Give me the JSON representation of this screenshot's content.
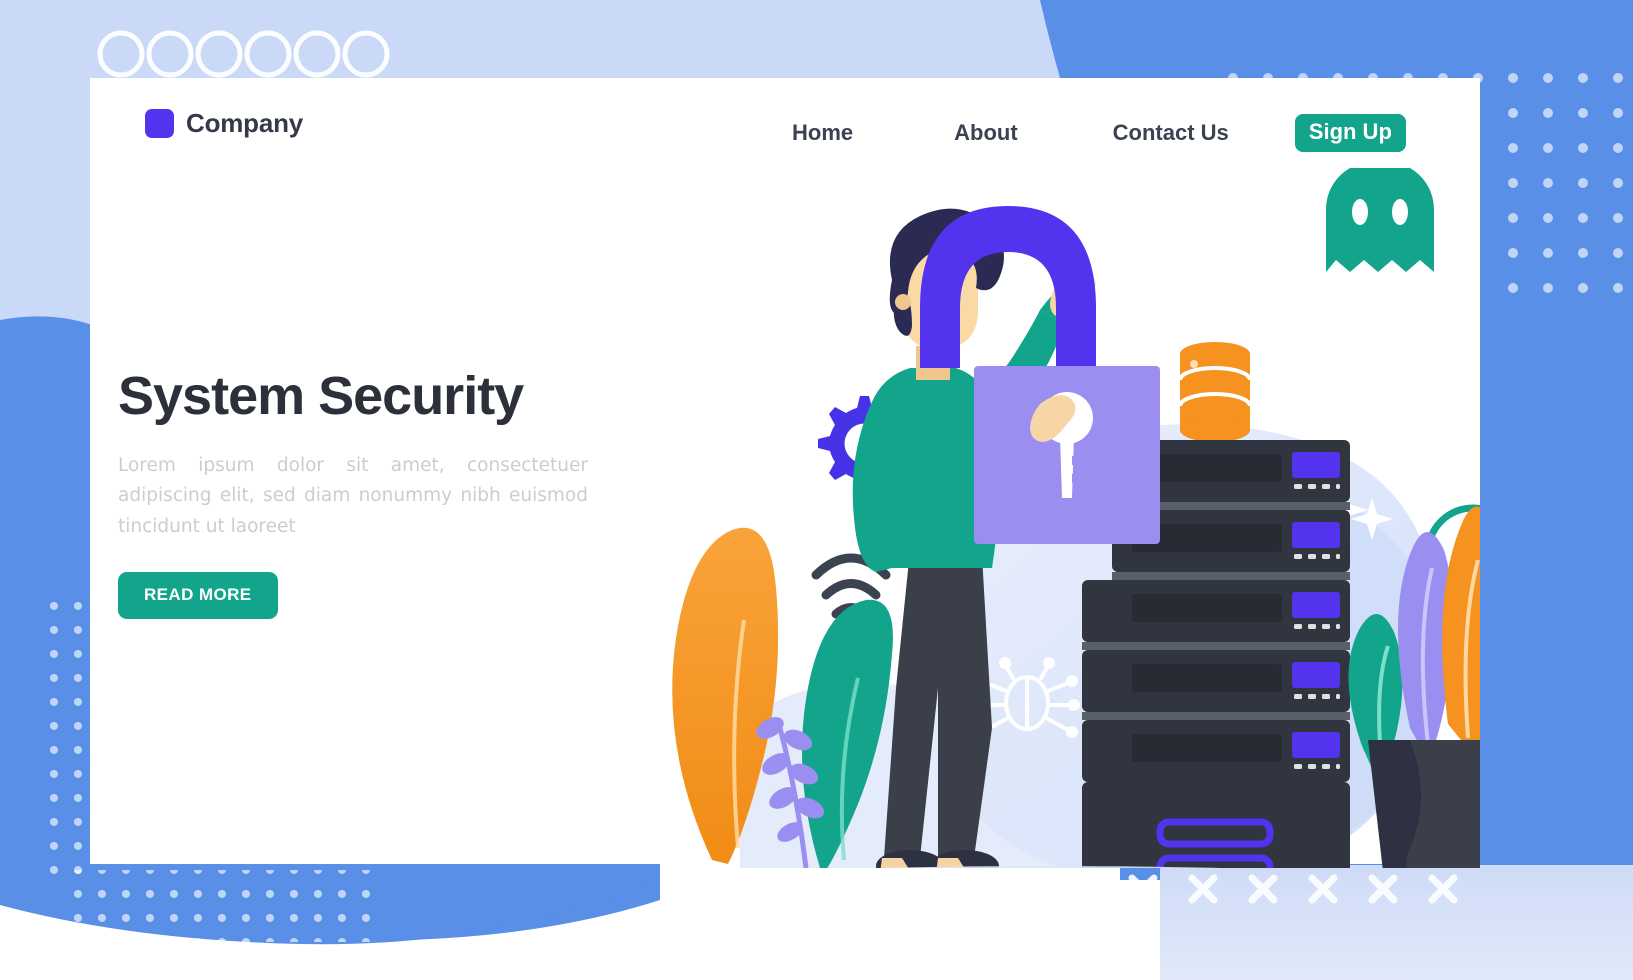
{
  "header": {
    "brand": {
      "name": "Company",
      "mark_color": "#5433EE"
    },
    "nav_links": [
      {
        "label": "Home"
      },
      {
        "label": "About"
      },
      {
        "label": "Contact Us"
      }
    ],
    "signup": {
      "label": "Sign Up",
      "bg_color": "#12a58c",
      "text_color": "#ffffff"
    }
  },
  "hero": {
    "title": "System Security",
    "subtitle": "Lorem ipsum dolor sit amet, consectetuer adipiscing elit, sed diam nonummy nibh euismod tincidunt ut laoreet",
    "cta": {
      "label": "READ MORE",
      "bg_color": "#12a58c",
      "text_color": "#ffffff"
    }
  },
  "illustration": {
    "name": "system-security-illustration",
    "elements": [
      "padlock",
      "person",
      "server-rack",
      "database-cylinder",
      "gear-icon",
      "wifi-icon",
      "bug-icon",
      "ghost-icon",
      "sparkle-icon",
      "circle-outline",
      "plant-leaves",
      "plant-pot"
    ]
  },
  "colors": {
    "page_background": "#5a8fe8",
    "card_background": "#ffffff",
    "primary_purple": "#5433EE",
    "light_purple": "#9a8ef0",
    "teal": "#12a58c",
    "orange": "#f59220",
    "dark_navy": "#2d3142",
    "pale_blue": "#dae4fa",
    "title_color": "#2b303b",
    "body_text": "#c9cdd4"
  },
  "decorations": {
    "top_circles_count": 6,
    "dot_grid_left": true,
    "dot_grid_right": true,
    "x_marks_bottom_count": 6
  }
}
